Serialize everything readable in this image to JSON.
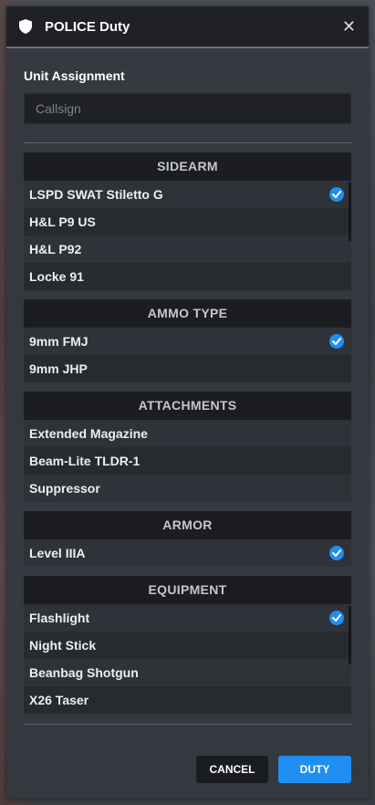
{
  "header": {
    "title": "POLICE Duty",
    "close_icon": "close-icon",
    "shield_icon": "shield-icon"
  },
  "unit": {
    "label": "Unit Assignment",
    "placeholder": "Callsign",
    "value": ""
  },
  "groups": [
    {
      "title": "SIDEARM",
      "items": [
        {
          "label": "LSPD SWAT Stiletto G",
          "selected": true
        },
        {
          "label": "H&L P9 US",
          "selected": false
        },
        {
          "label": "H&L P92",
          "selected": false
        },
        {
          "label": "Locke 91",
          "selected": false
        }
      ]
    },
    {
      "title": "AMMO TYPE",
      "items": [
        {
          "label": "9mm FMJ",
          "selected": true
        },
        {
          "label": "9mm JHP",
          "selected": false
        }
      ]
    },
    {
      "title": "ATTACHMENTS",
      "items": [
        {
          "label": "Extended Magazine",
          "selected": false
        },
        {
          "label": "Beam-Lite TLDR-1",
          "selected": false
        },
        {
          "label": "Suppressor",
          "selected": false
        }
      ]
    },
    {
      "title": "ARMOR",
      "items": [
        {
          "label": "Level IIIA",
          "selected": true
        }
      ]
    },
    {
      "title": "EQUIPMENT",
      "items": [
        {
          "label": "Flashlight",
          "selected": true
        },
        {
          "label": "Night Stick",
          "selected": false
        },
        {
          "label": "Beanbag Shotgun",
          "selected": false
        },
        {
          "label": "X26 Taser",
          "selected": false
        }
      ]
    }
  ],
  "footer": {
    "cancel_label": "CANCEL",
    "duty_label": "DUTY"
  },
  "colors": {
    "accent": "#1f8ef1",
    "header_bg": "#1f2126",
    "panel_bg": "#34383f"
  }
}
